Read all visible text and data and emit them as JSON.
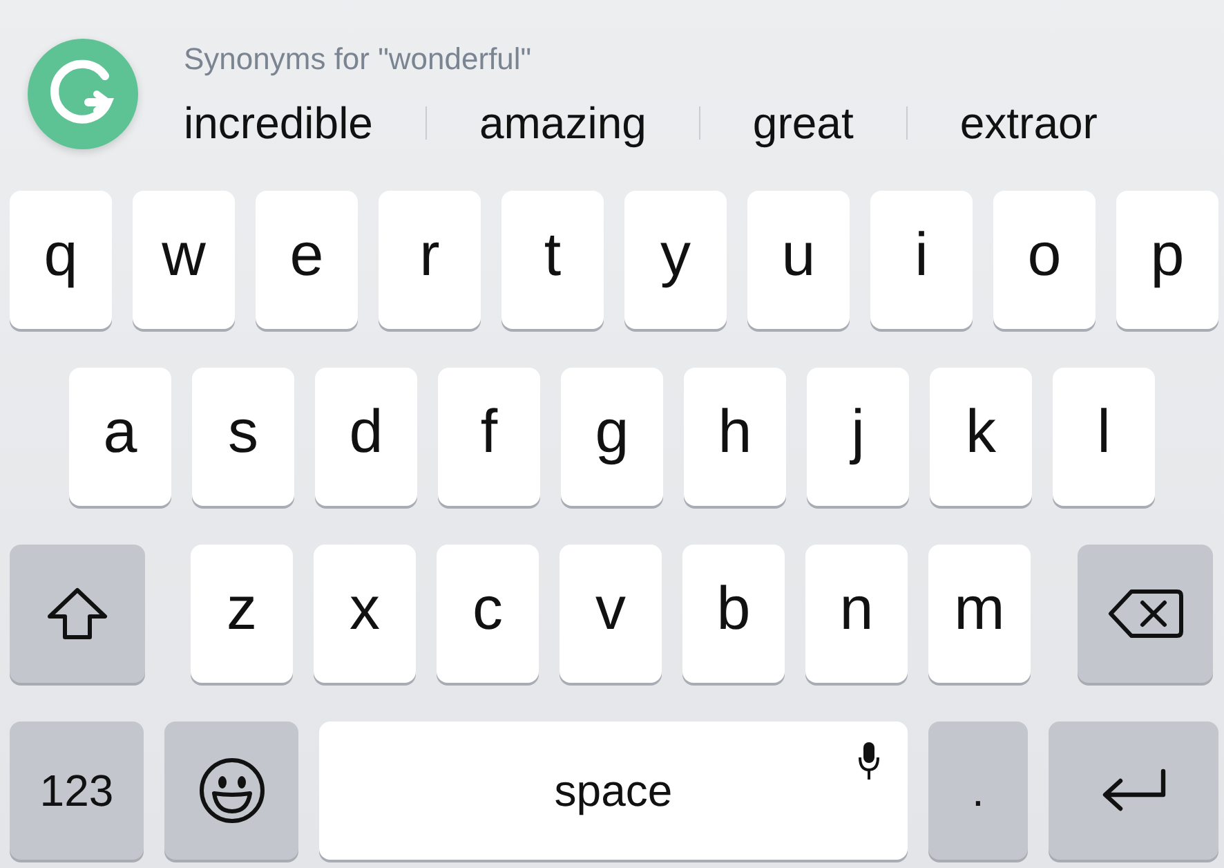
{
  "suggestions": {
    "header": "Synonyms for \"wonderful\"",
    "words": [
      "incredible",
      "amazing",
      "great",
      "extraor"
    ]
  },
  "rows": [
    [
      {
        "kind": "letter",
        "label": "q"
      },
      {
        "kind": "letter",
        "label": "w"
      },
      {
        "kind": "letter",
        "label": "e"
      },
      {
        "kind": "letter",
        "label": "r"
      },
      {
        "kind": "letter",
        "label": "t"
      },
      {
        "kind": "letter",
        "label": "y"
      },
      {
        "kind": "letter",
        "label": "u"
      },
      {
        "kind": "letter",
        "label": "i"
      },
      {
        "kind": "letter",
        "label": "o"
      },
      {
        "kind": "letter",
        "label": "p"
      }
    ],
    [
      {
        "kind": "letter",
        "label": "a"
      },
      {
        "kind": "letter",
        "label": "s"
      },
      {
        "kind": "letter",
        "label": "d"
      },
      {
        "kind": "letter",
        "label": "f"
      },
      {
        "kind": "letter",
        "label": "g"
      },
      {
        "kind": "letter",
        "label": "h"
      },
      {
        "kind": "letter",
        "label": "j"
      },
      {
        "kind": "letter",
        "label": "k"
      },
      {
        "kind": "letter",
        "label": "l"
      }
    ],
    [
      {
        "kind": "shift"
      },
      {
        "kind": "letter",
        "label": "z"
      },
      {
        "kind": "letter",
        "label": "x"
      },
      {
        "kind": "letter",
        "label": "c"
      },
      {
        "kind": "letter",
        "label": "v"
      },
      {
        "kind": "letter",
        "label": "b"
      },
      {
        "kind": "letter",
        "label": "n"
      },
      {
        "kind": "letter",
        "label": "m"
      },
      {
        "kind": "backspace"
      }
    ],
    [
      {
        "kind": "numbers",
        "label": "123"
      },
      {
        "kind": "emoji"
      },
      {
        "kind": "space",
        "label": "space"
      },
      {
        "kind": "period",
        "label": "."
      },
      {
        "kind": "return"
      }
    ]
  ]
}
